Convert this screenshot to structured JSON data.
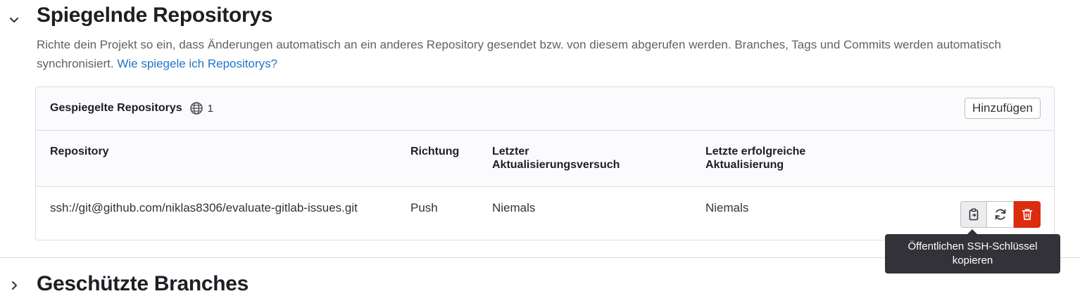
{
  "mirror_section": {
    "title": "Spiegelnde Repositorys",
    "description": "Richte dein Projekt so ein, dass Änderungen automatisch an ein anderes Repository gesendet bzw. von diesem abgerufen werden. Branches, Tags und Commits werden automatisch synchronisiert.",
    "help_link": "Wie spiegele ich Repositorys?",
    "expanded": true
  },
  "mirrors_card": {
    "title": "Gespiegelte Repositorys",
    "count": "1",
    "add_label": "Hinzufügen",
    "columns": {
      "repository": "Repository",
      "direction": "Richtung",
      "last_attempt": "Letzter Aktualisierungsversuch",
      "last_success": "Letzte erfolgreiche Aktualisierung"
    },
    "rows": [
      {
        "repository": "ssh://git@github.com/niklas8306/evaluate-gitlab-issues.git",
        "direction": "Push",
        "last_attempt": "Niemals",
        "last_success": "Niemals"
      }
    ]
  },
  "tooltip": {
    "text": "Öffentlichen SSH-Schlüssel kopieren"
  },
  "next_section": {
    "title": "Geschützte Branches",
    "expanded": false
  },
  "colors": {
    "link": "#1f75cb",
    "danger": "#dd2b0e",
    "tooltip_bg": "#333238"
  },
  "icons": [
    "chevron-down-icon",
    "globe-icon",
    "copy-to-clipboard-icon",
    "retry-icon",
    "trash-icon",
    "chevron-right-icon"
  ]
}
